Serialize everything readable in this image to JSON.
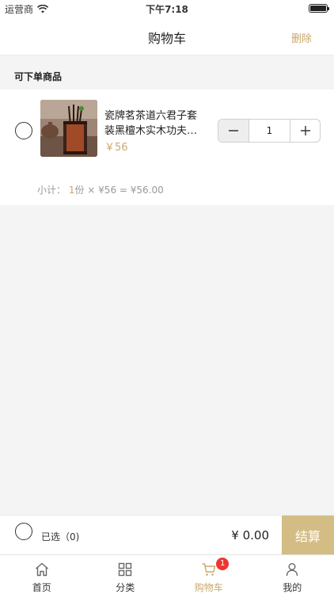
{
  "status_bar": {
    "carrier": "运营商",
    "time": "下午7:18"
  },
  "nav": {
    "title": "购物车",
    "delete_label": "删除"
  },
  "section": {
    "header": "可下单商品"
  },
  "cart_item": {
    "name_line1": "瓷牌茗茶道六君子套",
    "name_line2": "装黑檀木实木功夫…",
    "price": "￥56",
    "quantity": "1",
    "subtotal_label": "小计：",
    "subtotal_count": "1",
    "subtotal_rest": "份 × ¥56 = ¥56.00"
  },
  "checkout": {
    "selected_label": "已选（0)",
    "total": "¥ 0.00",
    "pay_label": "结算"
  },
  "tabs": [
    {
      "label": "首页",
      "icon": "home-icon"
    },
    {
      "label": "分类",
      "icon": "grid-icon"
    },
    {
      "label": "购物车",
      "icon": "cart-icon",
      "badge": "1",
      "active": true
    },
    {
      "label": "我的",
      "icon": "user-icon"
    }
  ],
  "colors": {
    "accent": "#c9a86a",
    "pay_button": "#d3bd85",
    "badge": "#f0352f"
  }
}
